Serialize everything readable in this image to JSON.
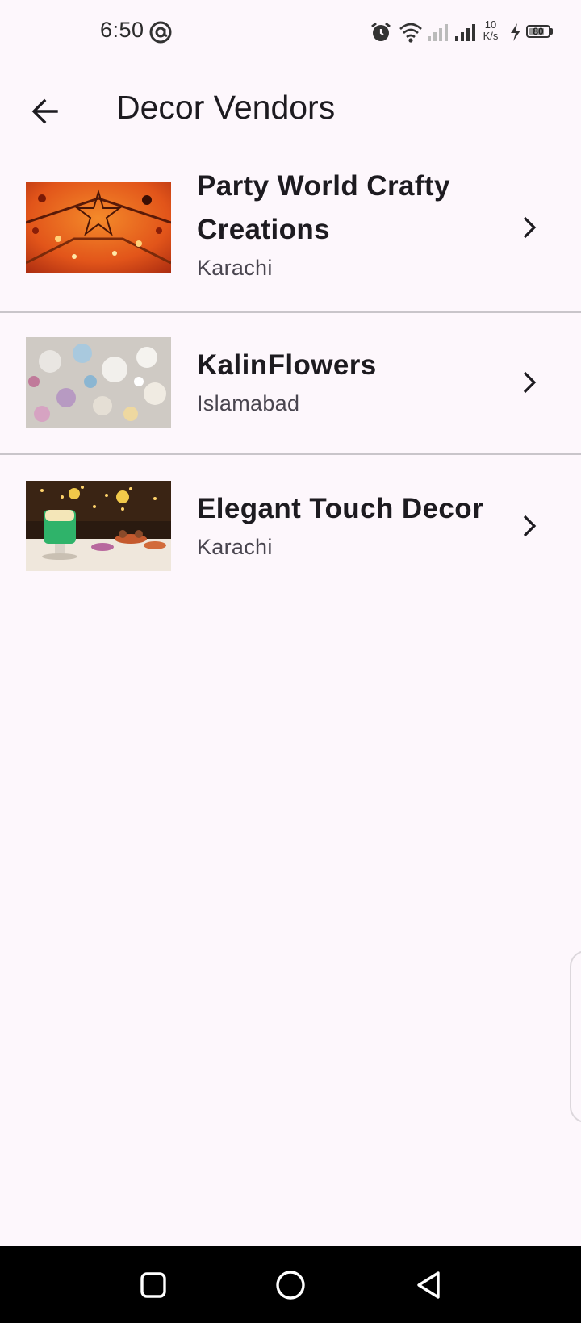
{
  "status_bar": {
    "time": "6:50",
    "net_speed_value": "10",
    "net_speed_unit": "K/s",
    "battery_level": "80",
    "battery_fraction": 0.8,
    "icons": [
      "at-sign-icon",
      "alarm-icon",
      "wifi-icon",
      "signal-weak-icon",
      "signal-strong-icon",
      "charging-icon",
      "battery-icon"
    ]
  },
  "app_bar": {
    "title": "Decor Vendors",
    "back_icon": "arrow-left-icon"
  },
  "vendors": [
    {
      "name": "Party World Crafty Creations",
      "city": "Karachi",
      "image": "party-decor-photo"
    },
    {
      "name": "KalinFlowers",
      "city": "Islamabad",
      "image": "flowers-photo"
    },
    {
      "name": "Elegant Touch Decor",
      "city": "Karachi",
      "image": "cake-table-photo"
    }
  ],
  "colors": {
    "background": "#fdf7fc",
    "text_primary": "#1d1b20",
    "text_secondary": "#49454f",
    "divider": "#c9c5ca",
    "nav_bar": "#000000"
  },
  "nav_bar": {
    "icons": [
      "recent-apps-icon",
      "home-icon",
      "back-triangle-icon"
    ]
  }
}
